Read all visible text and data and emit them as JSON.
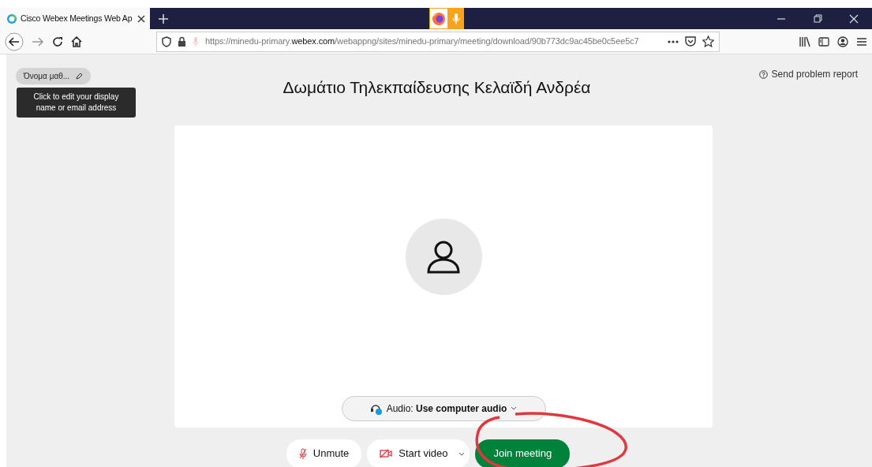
{
  "browser": {
    "tab": {
      "title": "Cisco Webex Meetings Web Ap",
      "selected": true
    },
    "url_parts": [
      "https://minedu-primary.",
      "webex.com",
      "/webappng/sites/minedu-primary/meeting/download/90b773dc9ac45be0c5ee5c7"
    ]
  },
  "page": {
    "name_chip": "Όνομα μαθ...",
    "tooltip": "Click to edit your display name or email address",
    "title": "Δωμάτιο Τηλεκπαίδευσης Κελαϊδή Ανδρέα",
    "report_link": "Send problem report",
    "audio": {
      "label": "Audio:",
      "value": "Use computer audio"
    },
    "buttons": [
      {
        "kind": "mute",
        "label": "Unmute"
      },
      {
        "kind": "video",
        "label": "Start video"
      },
      {
        "kind": "join",
        "label": "Join meeting"
      }
    ]
  }
}
